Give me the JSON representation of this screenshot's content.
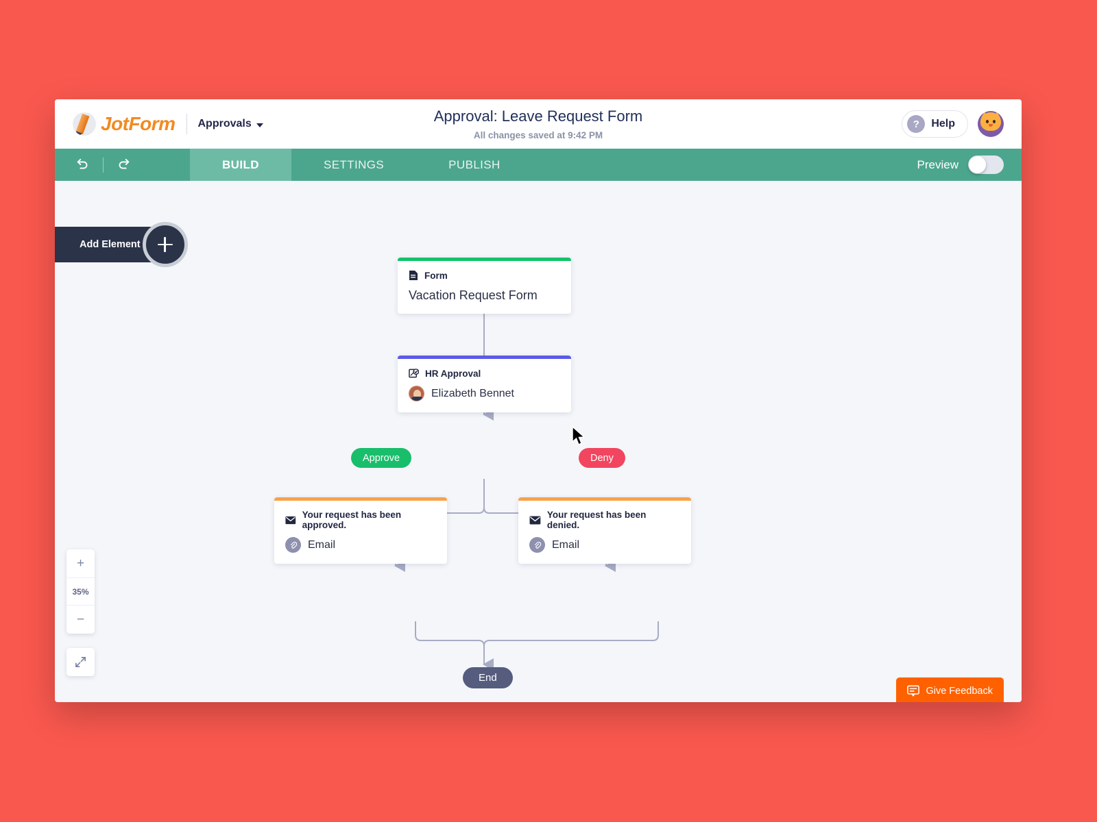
{
  "header": {
    "brand_name": "JotForm",
    "section": "Approvals",
    "title": "Approval: Leave Request Form",
    "status": "All changes saved at 9:42 PM",
    "help_label": "Help",
    "help_glyph": "?"
  },
  "toolbar": {
    "undo_icon": "undo-arrow-icon",
    "redo_icon": "redo-arrow-icon",
    "tabs": [
      {
        "label": "BUILD",
        "active": true
      },
      {
        "label": "SETTINGS",
        "active": false
      },
      {
        "label": "PUBLISH",
        "active": false
      }
    ],
    "preview_label": "Preview",
    "preview_on": false,
    "bar_color": "#4CA68D",
    "active_tab_color": "#6DBBA5"
  },
  "canvas": {
    "add_element_label": "Add Element",
    "nodes": {
      "form": {
        "kicker": "Form",
        "title": "Vacation Request Form",
        "accent": "#14C26A",
        "icon": "document-icon"
      },
      "approval": {
        "kicker": "HR Approval",
        "assignee": "Elizabeth Bennet",
        "accent": "#5B5BE8",
        "icon": "approval-check-icon"
      },
      "email_approved": {
        "kicker": "Your request has been approved.",
        "channel": "Email",
        "accent": "#F7A24B",
        "icon": "envelope-icon"
      },
      "email_denied": {
        "kicker": "Your request has been denied.",
        "channel": "Email",
        "accent": "#F7A24B",
        "icon": "envelope-icon"
      }
    },
    "branches": {
      "approve_label": "Approve",
      "approve_color": "#19BE6B",
      "deny_label": "Deny",
      "deny_color": "#F2455F"
    },
    "end_label": "End",
    "end_color": "#565C7E",
    "connector_color": "#A7ABC4"
  },
  "zoom": {
    "increase": "+",
    "level": "35%",
    "decrease": "−",
    "fit_icon": "fit-screen-icon"
  },
  "feedback": {
    "label": "Give Feedback",
    "icon": "speech-bubble-icon",
    "color": "#FF6100"
  }
}
